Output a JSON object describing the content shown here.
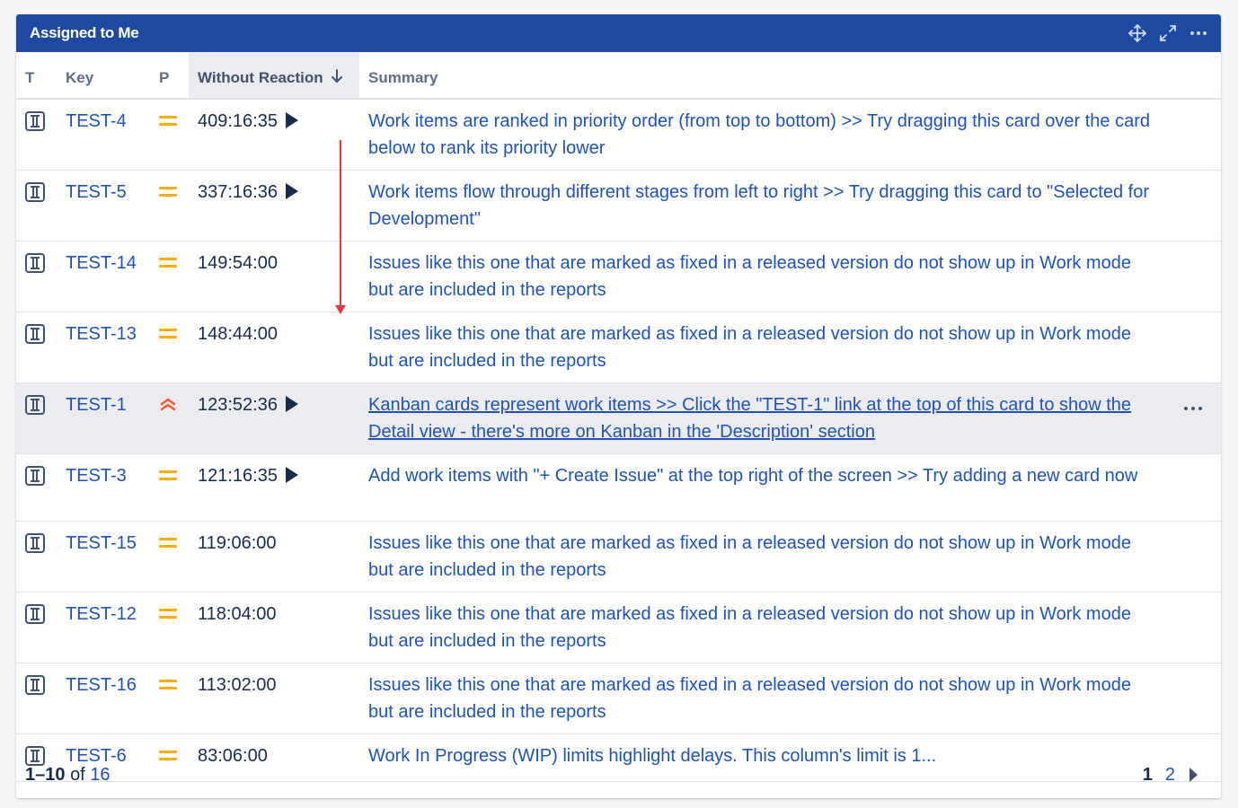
{
  "gadget": {
    "title": "Assigned to Me",
    "header_icons": [
      "move-icon",
      "expand-icon",
      "more-icon"
    ],
    "accent_color": "#1d4aa0"
  },
  "columns": {
    "type": "T",
    "key": "Key",
    "priority": "P",
    "without_reaction": "Without Reaction",
    "without_reaction_sort": "descending",
    "summary": "Summary"
  },
  "rows": [
    {
      "key": "TEST-4",
      "priority": "medium",
      "reaction": "409:16:35",
      "has_play": true,
      "summary": "Work items are ranked in priority order (from top to bottom) >> Try dragging this card over the card below to rank its priority lower"
    },
    {
      "key": "TEST-5",
      "priority": "medium",
      "reaction": "337:16:36",
      "has_play": true,
      "summary": "Work items flow through different stages from left to right >> Try dragging this card to \"Selected for Development\""
    },
    {
      "key": "TEST-14",
      "priority": "medium",
      "reaction": "149:54:00",
      "has_play": false,
      "summary": "Issues like this one that are marked as fixed in a released version do not show up in Work mode but are included in the reports"
    },
    {
      "key": "TEST-13",
      "priority": "medium",
      "reaction": "148:44:00",
      "has_play": false,
      "summary": "Issues like this one that are marked as fixed in a released version do not show up in Work mode but are included in the reports"
    },
    {
      "key": "TEST-1",
      "priority": "high",
      "reaction": "123:52:36",
      "has_play": true,
      "summary": "Kanban cards represent work items >> Click the \"TEST-1\" link at the top of this card to show the Detail view - there's more on Kanban in the 'Description' section",
      "hover": true
    },
    {
      "key": "TEST-3",
      "priority": "medium",
      "reaction": "121:16:35",
      "has_play": true,
      "summary": "Add work items with \"+ Create Issue\" at the top right of the screen >> Try adding a new card now"
    },
    {
      "key": "TEST-15",
      "priority": "medium",
      "reaction": "119:06:00",
      "has_play": false,
      "summary": "Issues like this one that are marked as fixed in a released version do not show up in Work mode but are included in the reports"
    },
    {
      "key": "TEST-12",
      "priority": "medium",
      "reaction": "118:04:00",
      "has_play": false,
      "summary": "Issues like this one that are marked as fixed in a released version do not show up in Work mode but are included in the reports"
    },
    {
      "key": "TEST-16",
      "priority": "medium",
      "reaction": "113:02:00",
      "has_play": false,
      "summary": "Issues like this one that are marked as fixed in a released version do not show up in Work mode but are included in the reports"
    },
    {
      "key": "TEST-6",
      "priority": "medium",
      "reaction": "83:06:00",
      "has_play": false,
      "summary": "Work In Progress (WIP) limits highlight delays. This column's limit is 1..."
    }
  ],
  "footer": {
    "range": "1–10",
    "of": "of",
    "total": "16",
    "pages": [
      "1",
      "2"
    ],
    "current_page": "1"
  },
  "colors": {
    "link": "#1e52b7",
    "priority_medium": "#ffab00",
    "priority_high": "#ff5630",
    "annotation_arrow": "#e0393e"
  }
}
